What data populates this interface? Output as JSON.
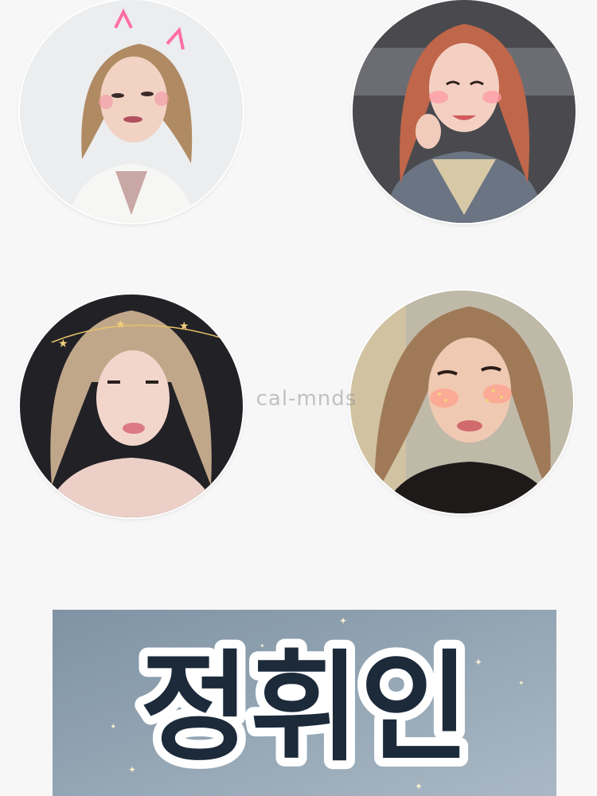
{
  "watermark": {
    "text": "cal-mnds"
  },
  "stickers": [
    {
      "name": "portrait-cat-ears",
      "background": "#ebedee",
      "hair": "#b08a63",
      "skin": "#f1d2c3"
    },
    {
      "name": "portrait-red-hair",
      "background": "#4a4a4e",
      "hair": "#c0664a",
      "skin": "#f3d0c2"
    },
    {
      "name": "portrait-star-crown",
      "background": "#222126",
      "hair": "#c1a78a",
      "skin": "#f2d6cc"
    },
    {
      "name": "portrait-freckles",
      "background": "#bfb9a8",
      "hair": "#a07a58",
      "skin": "#f0c9b3"
    }
  ],
  "banner": {
    "title": "정휘인",
    "gradient": [
      "#7f93a4",
      "#a9b8c4"
    ],
    "text_color": "#1c2a3a",
    "outline_color": "#ffffff"
  }
}
